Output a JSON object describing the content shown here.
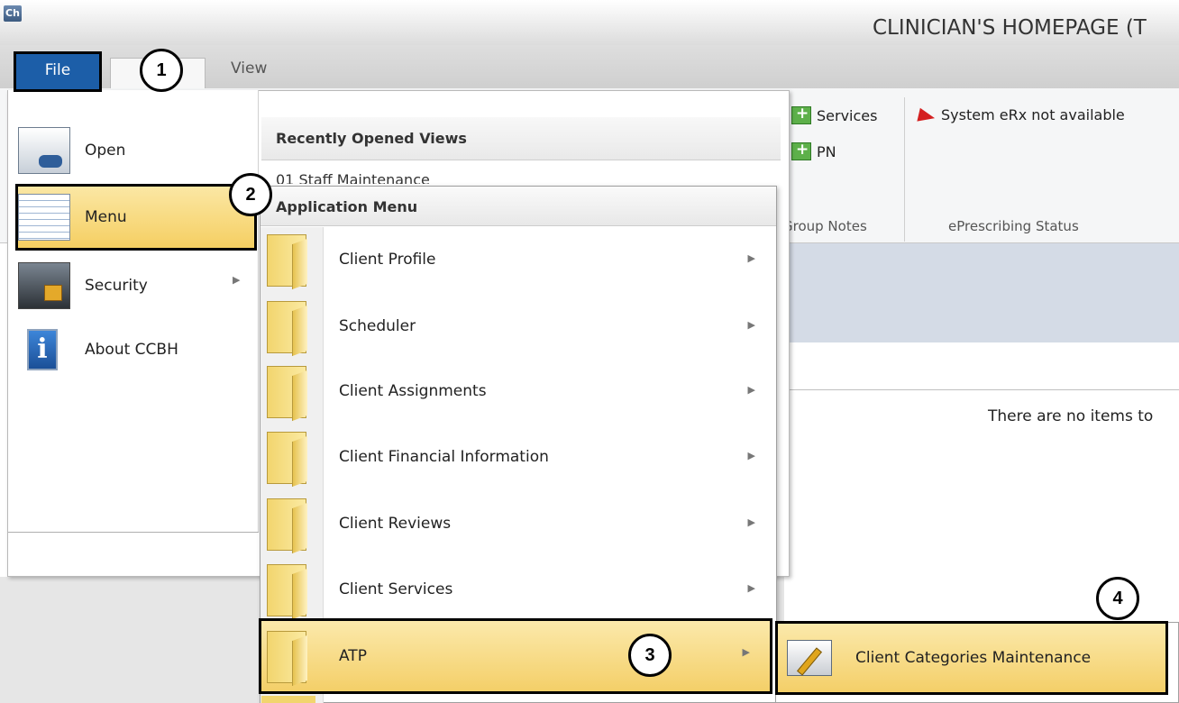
{
  "window": {
    "app_icon_text": "Ch",
    "title": "CLINICIAN'S HOMEPAGE (T"
  },
  "tabs": {
    "file": "File",
    "view": "View"
  },
  "ribbon": {
    "services": "Services",
    "pn": "PN",
    "erx_status": "System eRx not available",
    "group_notes_label": "Group Notes",
    "eprescribing_label": "ePrescribing Status"
  },
  "content": {
    "empty_message": "There are no items to"
  },
  "file_menu": {
    "items": [
      {
        "label": "Open",
        "icon": "open-icon"
      },
      {
        "label": "Menu",
        "icon": "menu-icon"
      },
      {
        "label": "Security",
        "icon": "security-icon"
      },
      {
        "label": "About CCBH",
        "icon": "info-icon"
      }
    ],
    "recent_title": "Recently Opened Views",
    "recent_items": [
      "01 Staff Maintenance"
    ]
  },
  "app_menu": {
    "title": "Application Menu",
    "items": [
      {
        "label": "Client Profile",
        "icon": "folder-icon"
      },
      {
        "label": "Scheduler",
        "icon": "folder-icon"
      },
      {
        "label": "Client Assignments",
        "icon": "folder-icon"
      },
      {
        "label": "Client Financial Information",
        "icon": "folder-icon"
      },
      {
        "label": "Client Reviews",
        "icon": "folder-icon"
      },
      {
        "label": "Client Services",
        "icon": "folder-icon"
      },
      {
        "label": "ATP",
        "icon": "folder-icon"
      }
    ]
  },
  "submenu": {
    "item": "Client Categories Maintenance",
    "icon": "pencil-window-icon"
  },
  "callouts": [
    "1",
    "2",
    "3",
    "4"
  ],
  "colors": {
    "highlight": "#f4cf68",
    "file_tab": "#1c5ea8",
    "erx_flag": "#d42020"
  }
}
